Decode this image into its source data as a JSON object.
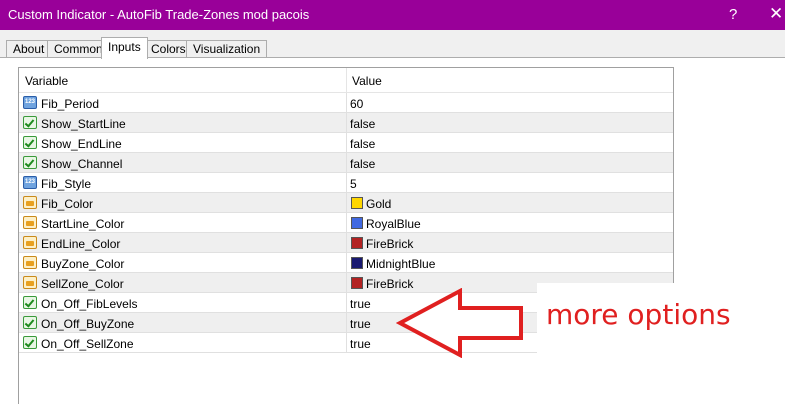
{
  "window": {
    "title": "Custom Indicator - AutoFib Trade-Zones mod pacois",
    "help_glyph": "?",
    "close_glyph": "✕"
  },
  "tabs": [
    {
      "label": "About",
      "active": false
    },
    {
      "label": "Common",
      "active": false
    },
    {
      "label": "Inputs",
      "active": true
    },
    {
      "label": "Colors",
      "active": false
    },
    {
      "label": "Visualization",
      "active": false
    }
  ],
  "grid": {
    "columns": [
      "Variable",
      "Value"
    ],
    "rows": [
      {
        "icon": "integer-icon",
        "name": "Fib_Period",
        "value": "60"
      },
      {
        "icon": "boolean-icon",
        "name": "Show_StartLine",
        "value": "false"
      },
      {
        "icon": "boolean-icon",
        "name": "Show_EndLine",
        "value": "false"
      },
      {
        "icon": "boolean-icon",
        "name": "Show_Channel",
        "value": "false"
      },
      {
        "icon": "integer-icon",
        "name": "Fib_Style",
        "value": "5"
      },
      {
        "icon": "color-icon",
        "name": "Fib_Color",
        "value": "Gold",
        "swatch": "#FFD700"
      },
      {
        "icon": "color-icon",
        "name": "StartLine_Color",
        "value": "RoyalBlue",
        "swatch": "#4169E1"
      },
      {
        "icon": "color-icon",
        "name": "EndLine_Color",
        "value": "FireBrick",
        "swatch": "#B22222"
      },
      {
        "icon": "color-icon",
        "name": "BuyZone_Color",
        "value": "MidnightBlue",
        "swatch": "#191970"
      },
      {
        "icon": "color-icon",
        "name": "SellZone_Color",
        "value": "FireBrick",
        "swatch": "#B22222"
      },
      {
        "icon": "boolean-icon",
        "name": "On_Off_FibLevels",
        "value": "true"
      },
      {
        "icon": "boolean-icon",
        "name": "On_Off_BuyZone",
        "value": "true"
      },
      {
        "icon": "boolean-icon",
        "name": "On_Off_SellZone",
        "value": "true"
      }
    ]
  },
  "annotation": {
    "text": "more options",
    "color": "#E02020"
  },
  "colors": {
    "titlebar": "#990099",
    "integer_icon_text": "123"
  }
}
